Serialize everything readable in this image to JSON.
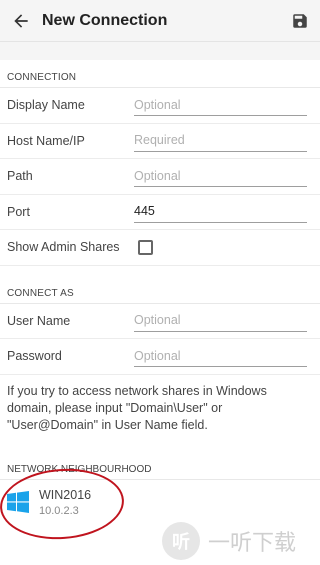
{
  "appbar": {
    "title": "New Connection",
    "back_icon": "arrow-left-icon",
    "save_icon": "floppy-disk-icon"
  },
  "connection": {
    "header": "CONNECTION",
    "display_name": {
      "label": "Display Name",
      "placeholder": "Optional",
      "value": ""
    },
    "host": {
      "label": "Host Name/IP",
      "placeholder": "Required",
      "value": ""
    },
    "path": {
      "label": "Path",
      "placeholder": "Optional",
      "value": ""
    },
    "port": {
      "label": "Port",
      "placeholder": "",
      "value": "445"
    },
    "show_admin": {
      "label": "Show Admin Shares",
      "checked": false
    }
  },
  "connect_as": {
    "header": "CONNECT AS",
    "user": {
      "label": "User Name",
      "placeholder": "Optional",
      "value": ""
    },
    "password": {
      "label": "Password",
      "placeholder": "Optional",
      "value": ""
    },
    "help": "If you try to access network shares in Windows domain, please input \"Domain\\User\" or \"User@Domain\" in User Name field."
  },
  "neighbourhood": {
    "header": "NETWORK NEIGHBOURHOOD",
    "hosts": [
      {
        "name": "WIN2016",
        "ip": "10.0.2.3",
        "icon": "windows-logo-icon"
      }
    ]
  },
  "watermark": {
    "badge": "听",
    "text": "一听下载"
  }
}
